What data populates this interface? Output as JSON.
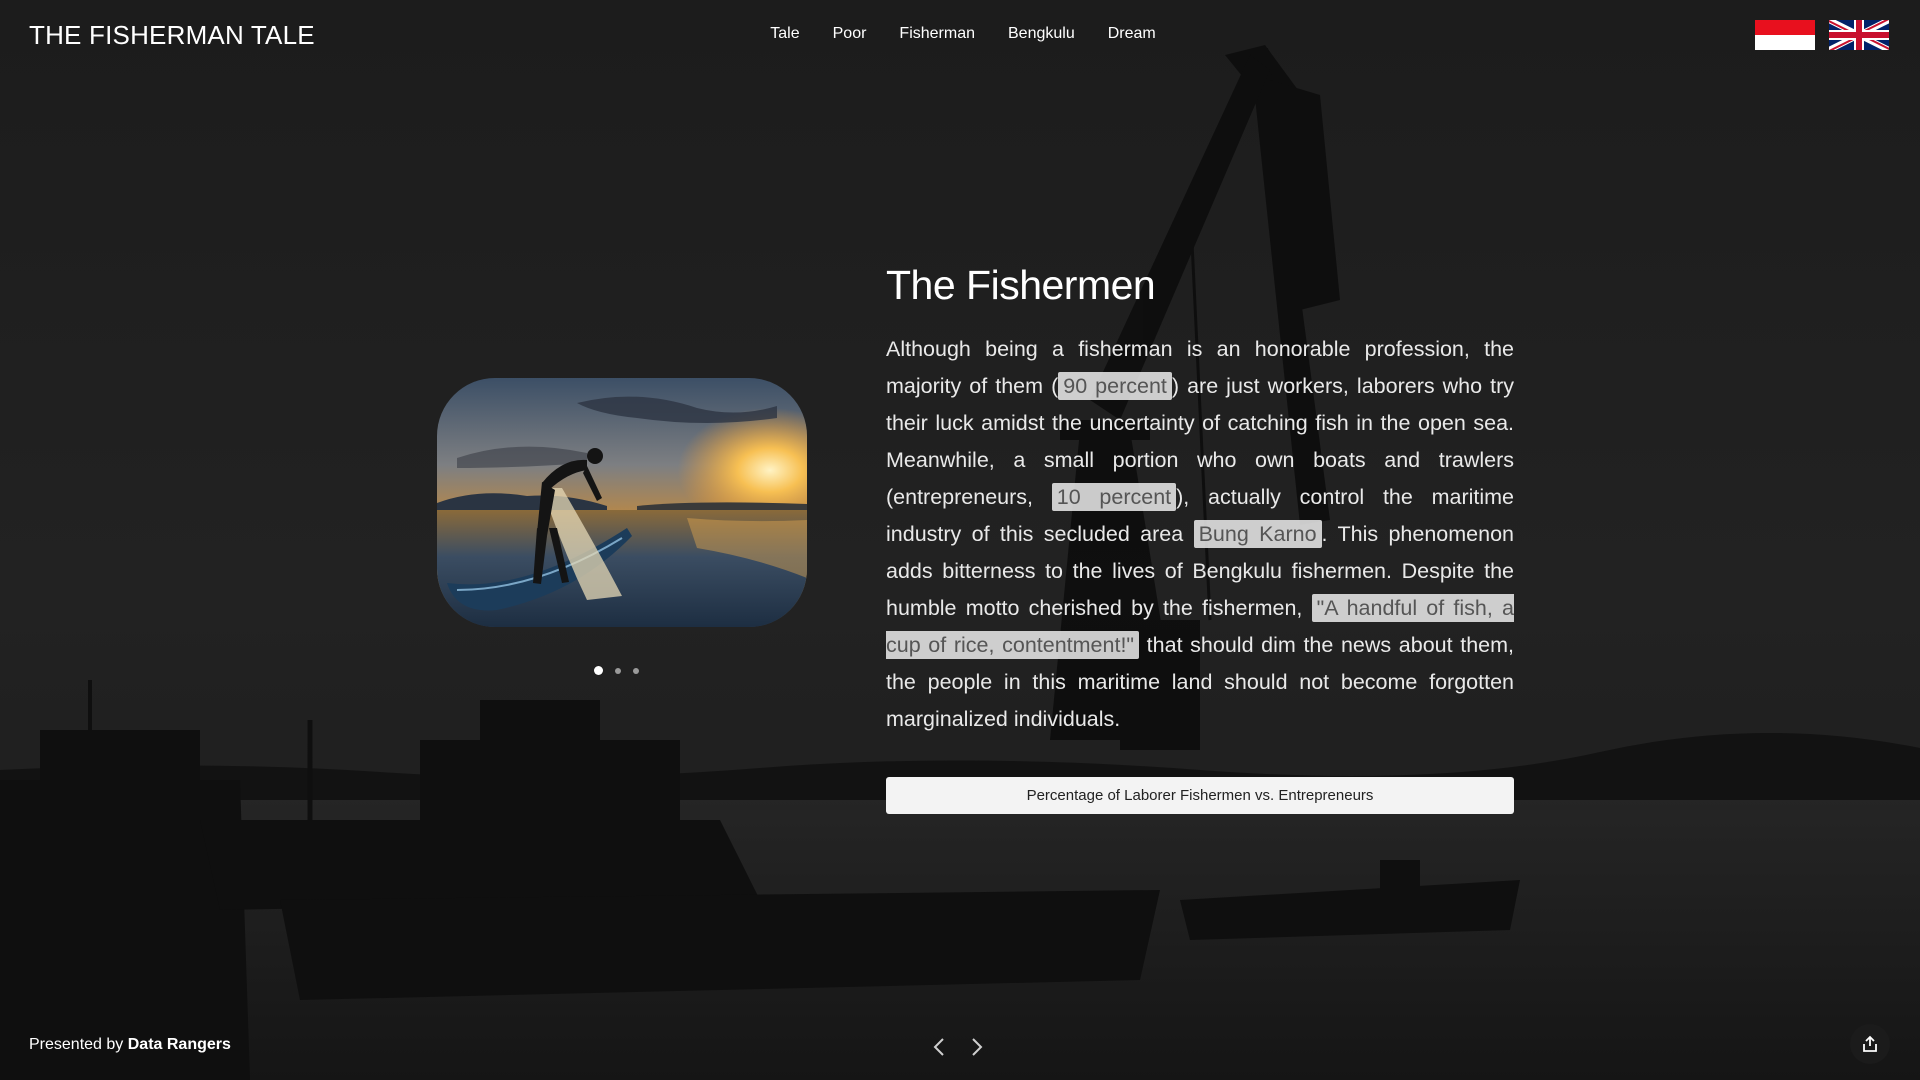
{
  "header": {
    "site_title": "THE FISHERMAN TALE",
    "nav": [
      "Tale",
      "Poor",
      "Fisherman",
      "Bengkulu",
      "Dream"
    ]
  },
  "languages": [
    {
      "icon": "indonesia-flag-icon",
      "colors": [
        "#e8101e",
        "#ffffff"
      ]
    },
    {
      "icon": "uk-flag-icon",
      "colors": [
        "#012169",
        "#ffffff",
        "#c8102e"
      ]
    }
  ],
  "carousel": {
    "slide_count": 3,
    "active_index": 0
  },
  "article": {
    "title": "The Fishermen",
    "p1": "Although being a fisherman is an honorable profession, the majority of them (",
    "h1": "90 percent",
    "p2": ") are just workers, laborers who try their luck amidst the uncertainty of catching fish in the open sea. Meanwhile, a small portion who own boats and trawlers (entrepreneurs, ",
    "h2": "10 percent",
    "p3": "), actually control the maritime industry of this secluded area ",
    "h3": "Bung Karno",
    "p4": ". This phenomenon adds bitterness to the lives of Bengkulu fishermen. Despite the humble motto cherished by the fishermen, ",
    "h4": "\"A handful of fish, a cup of rice, contentment!\"",
    "p5": " that should dim the news about them, the people in this maritime land should not become forgotten marginalized individuals.",
    "chart_button": "Percentage of Laborer Fishermen vs. Entrepreneurs"
  },
  "footer": {
    "credit_prefix": "Presented by ",
    "credit_name": "Data Rangers"
  },
  "icons": {
    "prev": "chevron-left-icon",
    "next": "chevron-right-icon",
    "share": "share-icon"
  },
  "colors": {
    "background": "#161616",
    "highlight_bg": "#e6e6e6",
    "button_bg": "#f3f3f3"
  }
}
